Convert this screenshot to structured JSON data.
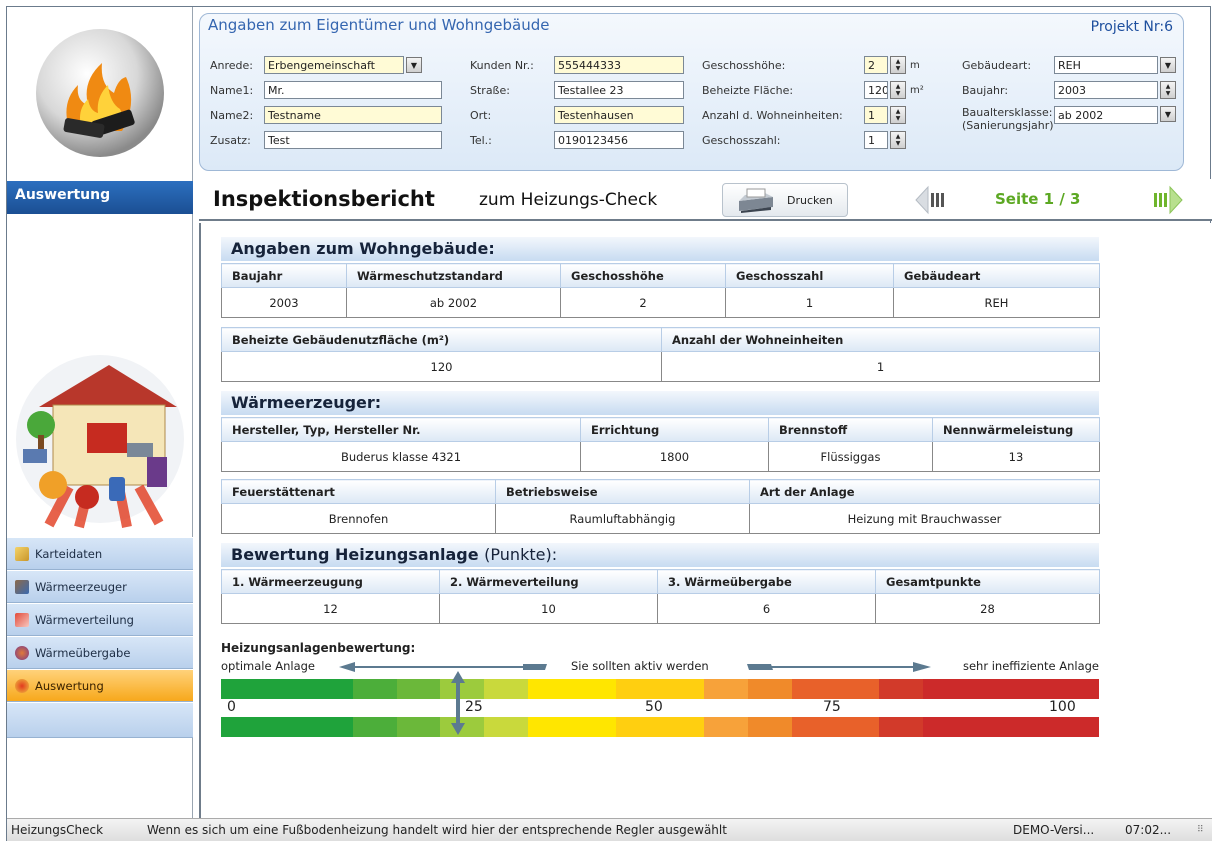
{
  "top_panel": {
    "title": "Angaben zum Eigentümer und Wohngebäude",
    "project_no": "Projekt Nr:6",
    "anrede_label": "Anrede:",
    "anrede_value": "Erbengemeinschaft",
    "name1_label": "Name1:",
    "name1_value": "Mr.",
    "name2_label": "Name2:",
    "name2_value": "Testname",
    "zusatz_label": "Zusatz:",
    "zusatz_value": "Test",
    "kunden_label": "Kunden Nr.:",
    "kunden_value": "555444333",
    "strasse_label": "Straße:",
    "strasse_value": "Testallee 23",
    "ort_label": "Ort:",
    "ort_value": "Testenhausen",
    "tel_label": "Tel.:",
    "tel_value": "0190123456",
    "geschosshoehe_label": "Geschosshöhe:",
    "geschosshoehe_value": "2",
    "geschosshoehe_unit": "m",
    "flaeche_label": "Beheizte Fläche:",
    "flaeche_value": "120",
    "flaeche_unit": "m²",
    "wohneinheiten_label": "Anzahl d. Wohneinheiten:",
    "wohneinheiten_value": "1",
    "geschosszahl_label": "Geschosszahl:",
    "geschosszahl_value": "1",
    "gebaeudeart_label": "Gebäudeart:",
    "gebaeudeart_value": "REH",
    "baujahr_label": "Baujahr:",
    "baujahr_value": "2003",
    "baualtersklasse_label": "Baualtersklasse:",
    "baualtersklasse_sub": "(Sanierungsjahr)",
    "baualtersklasse_value": "ab 2002"
  },
  "sidebar": {
    "header": "Auswertung",
    "items": [
      {
        "label": "Karteidaten"
      },
      {
        "label": "Wärmeerzeuger"
      },
      {
        "label": "Wärmeverteilung"
      },
      {
        "label": "Wärmeübergabe"
      },
      {
        "label": "Auswertung"
      }
    ]
  },
  "report_bar": {
    "title": "Inspektionsbericht",
    "subtitle": "zum Heizungs-Check",
    "print_label": "Drucken",
    "page": "Seite 1 / 3"
  },
  "report": {
    "sec1_title": "Angaben zum Wohngebäude:",
    "t1_headers": [
      "Baujahr",
      "Wärmeschutzstandard",
      "Geschosshöhe",
      "Geschosszahl",
      "Gebäudeart"
    ],
    "t1_values": [
      "2003",
      "ab 2002",
      "2",
      "1",
      "REH"
    ],
    "t2_headers": [
      "Beheizte Gebäudenutzfläche (m²)",
      "Anzahl der Wohneinheiten"
    ],
    "t2_values": [
      "120",
      "1"
    ],
    "sec2_title": "Wärmeerzeuger:",
    "t3_headers": [
      "Hersteller, Typ, Hersteller Nr.",
      "Errichtung",
      "Brennstoff",
      "Nennwärmeleistung"
    ],
    "t3_values": [
      "Buderus klasse 4321",
      "1800",
      "Flüssiggas",
      "13"
    ],
    "t4_headers": [
      "Feuerstättenart",
      "Betriebsweise",
      "Art der Anlage"
    ],
    "t4_values": [
      "Brennofen",
      "Raumluftabhängig",
      "Heizung mit Brauchwasser"
    ],
    "sec3_title": "Bewertung Heizungsanlage",
    "sec3_suffix": "(Punkte):",
    "t5_headers": [
      "1. Wärmeerzeugung",
      "2. Wärmeverteilung",
      "3. Wärmeübergabe",
      "Gesamtpunkte"
    ],
    "t5_values": [
      "12",
      "10",
      "6",
      "28"
    ],
    "scale_label": "Heizungsanlagenbewertung:",
    "legend_left": "optimale Anlage",
    "legend_mid": "Sie sollten aktiv werden",
    "legend_right": "sehr ineffiziente Anlage",
    "scale_ticks": [
      "0",
      "25",
      "50",
      "75",
      "100"
    ],
    "scale_value": 28,
    "scale_max": 100
  },
  "statusbar": {
    "app": "HeizungsCheck",
    "message": "Wenn es sich um eine Fußbodenheizung handelt wird hier der entsprechende Regler ausgewählt",
    "version": "DEMO-Versi...",
    "time": "07:02..."
  },
  "colors": {
    "accent_blue": "#1b4f93",
    "active_orange": "#f7a81b",
    "page_green": "#5ca823"
  }
}
